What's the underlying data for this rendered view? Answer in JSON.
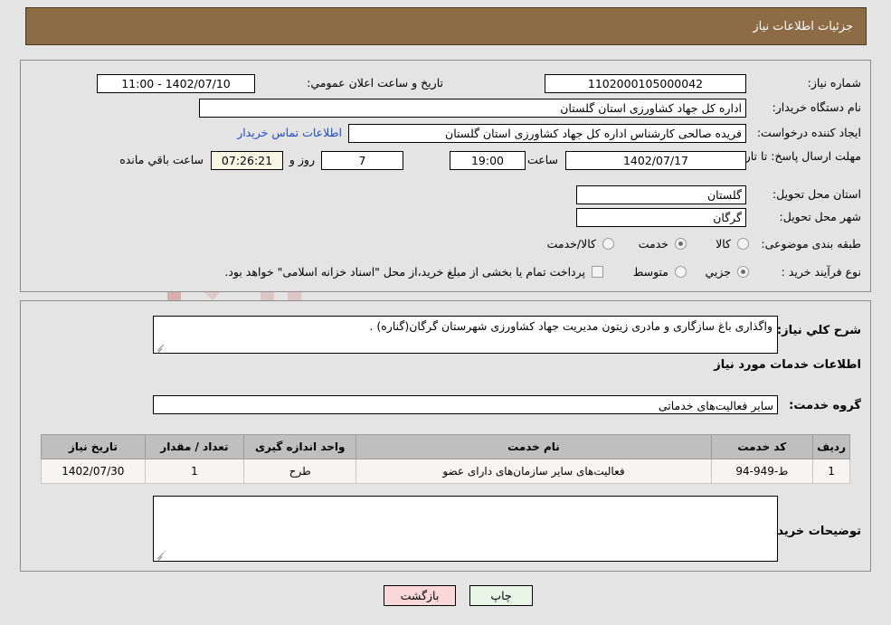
{
  "header": {
    "title": "جزئیات اطلاعات نیاز"
  },
  "watermark": {
    "text": "AriaTender.net"
  },
  "top_panel": {
    "need_number": {
      "label": "شماره نیاز:",
      "value": "1102000105000042"
    },
    "buyer_org": {
      "label": "نام دستگاه خریدار:",
      "value": "اداره کل جهاد کشاورزی استان گلستان"
    },
    "requester": {
      "label": "ایجاد کننده درخواست:",
      "value": "فریده صالحی کارشناس اداره کل جهاد کشاورزی استان گلستان"
    },
    "buyer_contact_link": "اطلاعات تماس خریدار",
    "public_announce": {
      "label": "تاریخ و ساعت اعلان عمومي:",
      "value": "1402/07/10 - 11:00"
    },
    "deadline": {
      "label": "مهلت ارسال پاسخ: تا تاریخ:",
      "date": "1402/07/17",
      "time_label": "ساعت",
      "time": "19:00",
      "days": "7",
      "days_suffix": "روز و",
      "countdown": "07:26:21",
      "countdown_suffix": "ساعت باقي مانده"
    },
    "delivery_province": {
      "label": "استان محل تحویل:",
      "value": "گلستان"
    },
    "delivery_city": {
      "label": "شهر محل تحویل:",
      "value": "گرگان"
    },
    "subject_category": {
      "label": "طبقه بندی موضوعی:",
      "options": [
        "کالا",
        "خدمت",
        "کالا/خدمت"
      ],
      "selected": "خدمت"
    },
    "purchase_process": {
      "label": "نوع فرآیند خرید :",
      "options": [
        "جزیي",
        "متوسط"
      ],
      "selected": "جزیي"
    },
    "treasury_note": {
      "checked": false,
      "text": "پرداخت تمام یا بخشی از مبلغ خرید،از محل \"اسناد خزانه اسلامی\" خواهد بود."
    }
  },
  "middle_panel": {
    "general_description": {
      "label": "شرح کلي نیاز:",
      "value": "واگذاری باغ سازگاری و مادری زیتون مدیریت جهاد کشاورزی شهرستان گرگان(گناره) ."
    },
    "services_heading": "اطلاعات خدمات مورد نیاز",
    "service_group": {
      "label": "گروه خدمت:",
      "value": "سایر فعالیت‌های خدماتی"
    },
    "table": {
      "columns": [
        "ردیف",
        "کد خدمت",
        "نام خدمت",
        "واحد اندازه گیری",
        "تعداد / مقدار",
        "تاریخ نیاز"
      ],
      "rows": [
        {
          "row_no": "1",
          "service_code": "ط-949-94",
          "service_name": "فعالیت‌های سایر سازمان‌های دارای عضو",
          "unit": "طرح",
          "quantity": "1",
          "need_date": "1402/07/30"
        }
      ]
    },
    "buyer_notes": {
      "label": "توضیحات خریدار;",
      "value": ""
    }
  },
  "footer": {
    "print_label": "چاپ",
    "return_label": "بازگشت"
  },
  "colors": {
    "header_bg": "#8d6b45",
    "page_bg": "#e4e4e4",
    "table_header_bg": "#bfbfbf",
    "link": "#1d4dcf",
    "print_btn": "#e8f6e8",
    "return_btn": "#fbd8d8",
    "countdown_bg": "#f8f7e4"
  }
}
